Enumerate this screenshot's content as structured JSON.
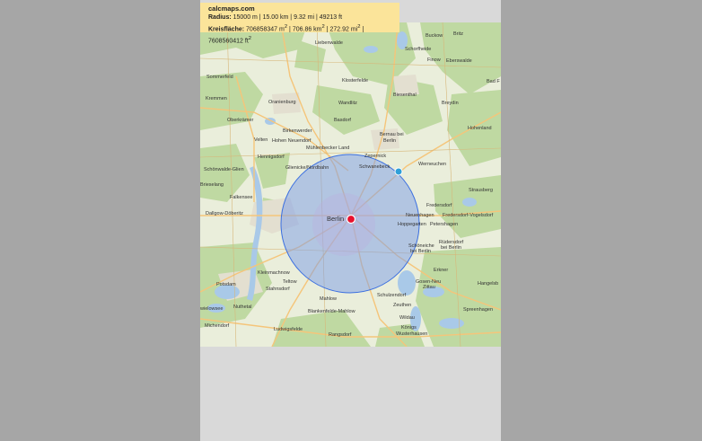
{
  "info": {
    "site": "calcmaps.com",
    "radius_label": "Radius:",
    "radius_values": "15000 m | 15.00 km | 9.32 mi | 49213 ft",
    "area_label": "Kreisfläche:",
    "area_m2": "706858347 m",
    "area_km2": "706.86 km",
    "area_mi2": "272.92 mi",
    "area_ft2": "7608560412 ft",
    "sup2": "2",
    "sep": " | "
  },
  "map": {
    "center_city": "Berlin",
    "marker_color": "#e8112d",
    "handle_color": "#2f9fd8",
    "circle_fill": "#7a9be8",
    "circle_stroke": "#3b6fe0",
    "places": {
      "liebenwalde": "Liebenwalde",
      "schorfheide": "Schorfheide",
      "buckow": "Buckow",
      "britz": "Britz",
      "finow": "Finow",
      "eberswalde": "Eberswalde",
      "sommerfeld": "Sommerfeld",
      "klosterfelde": "Klosterfelde",
      "badf": "Bad F",
      "kremmen": "Kremmen",
      "oranienburg": "Oranienburg",
      "biesenthal": "Biesenthal",
      "wandlitz": "Wandlitz",
      "breydin": "Breydin",
      "oberkraemer": "Oberkrämer",
      "basdorf": "Basdorf",
      "birkenwerder": "Birkenwerder",
      "hohenlanke": "Hohenland",
      "velten": "Velten",
      "hohenneuendorf": "Hohen Neuendorf",
      "muehlenbecker": "Mühlenbecker Land",
      "bernau": "Bernau bei\nBerlin",
      "hennigsdorf": "Hennigsdorf",
      "zepernick": "Zepernick",
      "schoenwalde": "Schönwalde-Glien",
      "glienicke": "Glienicke/Nordbahn",
      "schwanebeck": "Schwanebeck",
      "werneuchen": "Werneuchen",
      "brieselang": "Brieselang",
      "strausberg": "Strausberg",
      "falkensee": "Falkensee",
      "fredersdorf": "Fredersdorf",
      "dallgow": "Dallgow-Döberitz",
      "neuenhagen": "Neuenhagen",
      "fredersdorfvogelsdorf": "Fredersdorf-Vogelsdorf",
      "hoppegarten": "Hoppegarten",
      "petershagen": "Petershagen",
      "schoeneiche": "Schöneiche\nbei Berlin",
      "ruedersdorf": "Rüdersdorf\nbei Berlin",
      "kleinmachnow": "Kleinmachnow",
      "erkner": "Erkner",
      "potsdam": "Potsdam",
      "teltow": "Teltow",
      "gosen": "Gosen-Neu\nZittau",
      "hangelsberg": "Hangelsb",
      "stahnsdorf": "Stahnsdorf",
      "mahlow": "Mahlow",
      "schulzendorf": "Schulzendorf",
      "nuthetal": "Nuthetal",
      "zeuthen": "Zeuthen",
      "wielowsee": "Schwielowsee",
      "blankenfelde": "Blankenfelde-Mahlow",
      "wildau": "Wildau",
      "spreenhagen": "Spreenhagen",
      "michendorf": "Michendorf",
      "ludwigsfelde": "Ludwigsfelde",
      "koenigs": "Königs\nWusterhausen",
      "rangsdorf": "Rangsdorf"
    }
  }
}
